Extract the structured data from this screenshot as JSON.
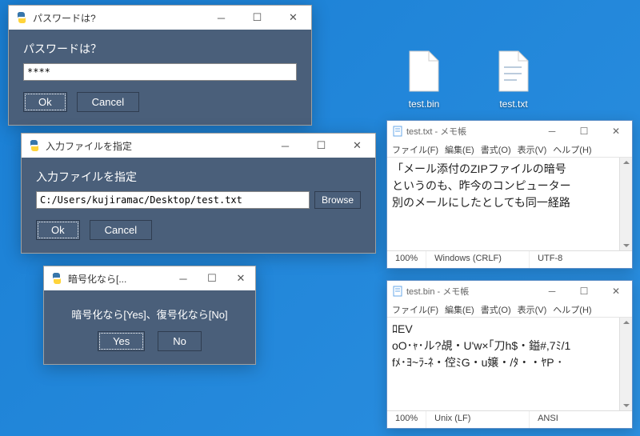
{
  "desktop": {
    "icons": [
      {
        "label": "test.bin"
      },
      {
        "label": "test.txt"
      }
    ]
  },
  "dialog_password": {
    "title": "パスワードは?",
    "prompt": "パスワードは？",
    "value": "****",
    "ok": "Ok",
    "cancel": "Cancel"
  },
  "dialog_file": {
    "title": "入力ファイルを指定",
    "prompt": "入力ファイルを指定",
    "path": "C:/Users/kujiramac/Desktop/test.txt",
    "browse": "Browse",
    "ok": "Ok",
    "cancel": "Cancel"
  },
  "dialog_mode": {
    "title": "暗号化なら[...",
    "prompt": "暗号化なら[Yes]、復号化なら[No]",
    "yes": "Yes",
    "no": "No"
  },
  "notepad_txt": {
    "title": "test.txt - メモ帳",
    "menu": [
      "ファイル(F)",
      "編集(E)",
      "書式(O)",
      "表示(V)",
      "ヘルプ(H)"
    ],
    "lines": [
      "「メール添付のZIPファイルの暗号",
      "というのも、昨今のコンピューター",
      "別のメールにしたとしても同一経路"
    ],
    "zoom": "100%",
    "eol": "Windows (CRLF)",
    "encoding": "UTF-8"
  },
  "notepad_bin": {
    "title": "test.bin - メモ帳",
    "menu": [
      "ファイル(F)",
      "編集(E)",
      "書式(O)",
      "表示(V)",
      "ヘルプ(H)"
    ],
    "lines": [
      "ﾛEV",
      "oO･ｬ･ル?覘・U'w×｢刀h$・鎰#,7ﾐ/1",
      "fﾒ･ﾖ~ﾗ-ﾈ・倥ﾐG・u嬢・/ﾀ・・ﾔP ･"
    ],
    "zoom": "100%",
    "eol": "Unix (LF)",
    "encoding": "ANSI"
  }
}
